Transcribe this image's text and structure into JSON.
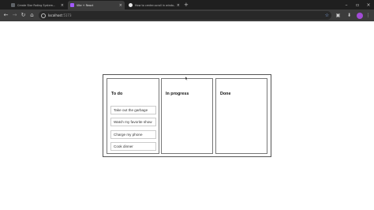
{
  "browser": {
    "tabs": [
      {
        "title": "Create Star Rating System...",
        "active": false,
        "favicon_color": "#5f6368"
      },
      {
        "title": "Vite + React",
        "active": true,
        "favicon_color": "#a259ff"
      },
      {
        "title": "How to center-scroll in windo...",
        "active": false,
        "favicon_color": "#e8e8e8"
      }
    ],
    "new_tab": "+",
    "address": {
      "host": "localhost",
      "port": ":5173"
    },
    "colors": {
      "tabstrip": "#1f1f1f",
      "toolbar": "#3c3c3c",
      "avatar": "#a24bd6"
    }
  },
  "board": {
    "columns": [
      {
        "title": "To do",
        "cards": [
          "Take out the garbage",
          "Watch my favorite show",
          "Charge my phone",
          "Cook dinner"
        ]
      },
      {
        "title": "In progress",
        "cards": []
      },
      {
        "title": "Done",
        "cards": []
      }
    ]
  }
}
